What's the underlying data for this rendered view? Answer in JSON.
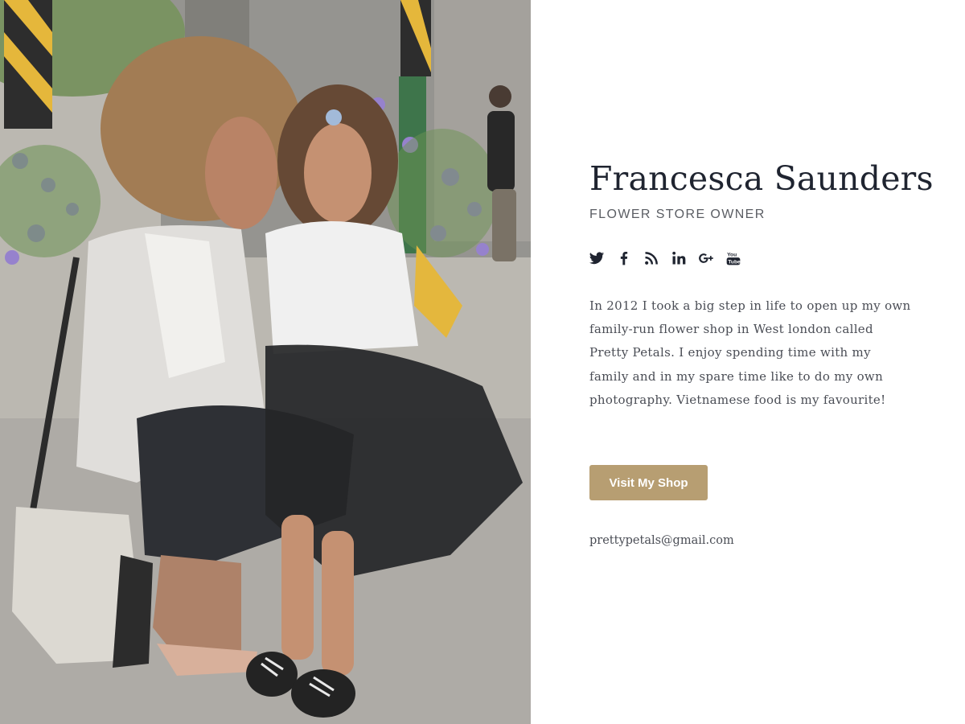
{
  "profile": {
    "name": "Francesca Saunders",
    "role": "FLOWER STORE OWNER",
    "bio": "In 2012 I took a big step in life to open up my own family-run flower shop in West london called Pretty Petals. I enjoy spending time with my family and in my spare time like to do my own photography. Vietnamese food is my favourite!",
    "button_label": "Visit My Shop",
    "email": "prettypetals@gmail.com"
  },
  "socials": [
    {
      "icon": "twitter-icon"
    },
    {
      "icon": "facebook-icon"
    },
    {
      "icon": "rss-icon"
    },
    {
      "icon": "linkedin-icon"
    },
    {
      "icon": "google-plus-icon"
    },
    {
      "icon": "youtube-icon"
    }
  ],
  "colors": {
    "accent": "#b79e72",
    "heading": "#1f2430",
    "text": "#4a4d55"
  }
}
